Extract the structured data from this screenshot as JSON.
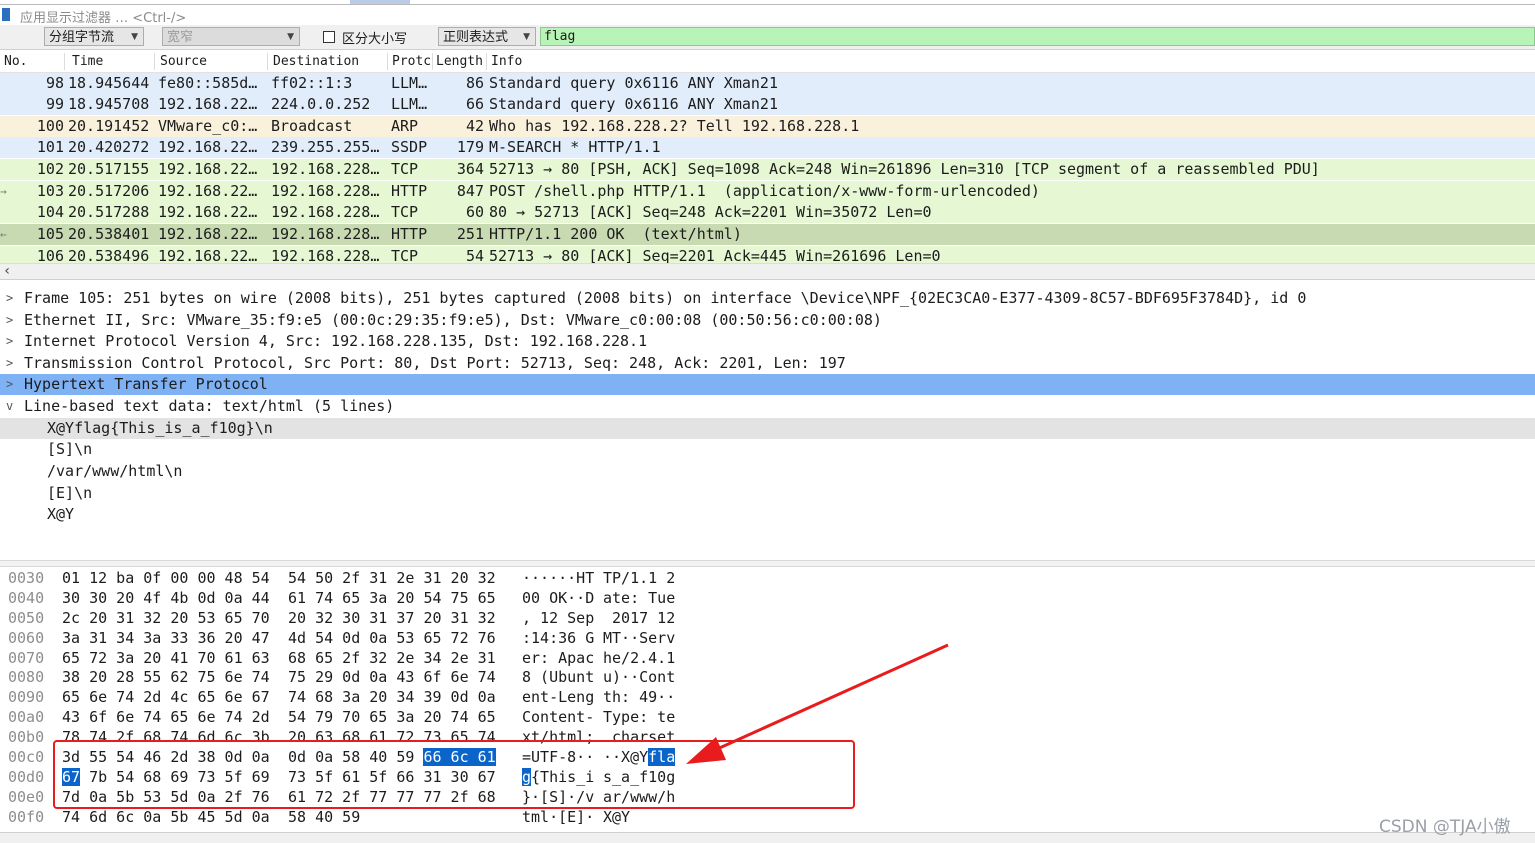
{
  "filter": {
    "placeholder": "应用显示过滤器 … <Ctrl-/>"
  },
  "find": {
    "display": "分组字节流",
    "charset": "宽窄",
    "case_label": "区分大小写",
    "search_type": "正则表达式",
    "query": "flag"
  },
  "packet_list": {
    "columns": [
      "No.",
      "Time",
      "Source",
      "Destination",
      "Protc",
      "Length",
      "Info"
    ],
    "rows": [
      {
        "no": "98",
        "time": "18.945644",
        "src": "fe80::585d…",
        "dst": "ff02::1:3",
        "proto": "LLM…",
        "len": "86",
        "info": "Standard query 0x6116 ANY Xman21",
        "bg": "#e2edfb"
      },
      {
        "no": "99",
        "time": "18.945708",
        "src": "192.168.22…",
        "dst": "224.0.0.252",
        "proto": "LLM…",
        "len": "66",
        "info": "Standard query 0x6116 ANY Xman21",
        "bg": "#e2edfb"
      },
      {
        "no": "100",
        "time": "20.191452",
        "src": "VMware_c0:…",
        "dst": "Broadcast",
        "proto": "ARP",
        "len": "42",
        "info": "Who has 192.168.228.2? Tell 192.168.228.1",
        "bg": "#faf1dd"
      },
      {
        "no": "101",
        "time": "20.420272",
        "src": "192.168.22…",
        "dst": "239.255.255…",
        "proto": "SSDP",
        "len": "179",
        "info": "M-SEARCH * HTTP/1.1",
        "bg": "#e2edfb"
      },
      {
        "no": "102",
        "time": "20.517155",
        "src": "192.168.22…",
        "dst": "192.168.228…",
        "proto": "TCP",
        "len": "364",
        "info": "52713 → 80 [PSH, ACK] Seq=1098 Ack=248 Win=261896 Len=310 [TCP segment of a reassembled PDU]",
        "bg": "#e6f7d4"
      },
      {
        "no": "103",
        "time": "20.517206",
        "src": "192.168.22…",
        "dst": "192.168.228…",
        "proto": "HTTP",
        "len": "847",
        "info": "POST /shell.php HTTP/1.1  (application/x-www-form-urlencoded)",
        "bg": "#e6f7d4"
      },
      {
        "no": "104",
        "time": "20.517288",
        "src": "192.168.22…",
        "dst": "192.168.228…",
        "proto": "TCP",
        "len": "60",
        "info": "80 → 52713 [ACK] Seq=248 Ack=2201 Win=35072 Len=0",
        "bg": "#e6f7d4"
      },
      {
        "no": "105",
        "time": "20.538401",
        "src": "192.168.22…",
        "dst": "192.168.228…",
        "proto": "HTTP",
        "len": "251",
        "info": "HTTP/1.1 200 OK  (text/html)",
        "bg": "#c8dab2"
      },
      {
        "no": "106",
        "time": "20.538496",
        "src": "192.168.22…",
        "dst": "192.168.228…",
        "proto": "TCP",
        "len": "54",
        "info": "52713 → 80 [ACK] Seq=2201 Ack=445 Win=261696 Len=0",
        "bg": "#e6f7d4"
      }
    ]
  },
  "details": {
    "rows": [
      {
        "text": "Frame 105: 251 bytes on wire (2008 bits), 251 bytes captured (2008 bits) on interface \\Device\\NPF_{02EC3CA0-E377-4309-8C57-BDF695F3784D}, id 0",
        "expand": ">"
      },
      {
        "text": "Ethernet II, Src: VMware_35:f9:e5 (00:0c:29:35:f9:e5), Dst: VMware_c0:00:08 (00:50:56:c0:00:08)",
        "expand": ">"
      },
      {
        "text": "Internet Protocol Version 4, Src: 192.168.228.135, Dst: 192.168.228.1",
        "expand": ">"
      },
      {
        "text": "Transmission Control Protocol, Src Port: 80, Dst Port: 52713, Seq: 248, Ack: 2201, Len: 197",
        "expand": ">"
      },
      {
        "text": "Hypertext Transfer Protocol",
        "expand": ">"
      },
      {
        "text": "Line-based text data: text/html (5 lines)",
        "expand": "v"
      }
    ],
    "children": [
      "X@Yflag{This_is_a_f10g}\\n",
      "[S]\\n",
      "/var/www/html\\n",
      "[E]\\n",
      "X@Y"
    ]
  },
  "hex": [
    {
      "off": "0030",
      "h1": "01 12 ba 0f 00 00 48 54",
      "h2": "54 50 2f 31 2e 31 20 32",
      "a1": "······HT",
      "a2": "TP/1.1 2"
    },
    {
      "off": "0040",
      "h1": "30 30 20 4f 4b 0d 0a 44",
      "h2": "61 74 65 3a 20 54 75 65",
      "a1": "00 OK··D",
      "a2": "ate: Tue"
    },
    {
      "off": "0050",
      "h1": "2c 20 31 32 20 53 65 70",
      "h2": "20 32 30 31 37 20 31 32",
      "a1": ", 12 Sep",
      "a2": " 2017 12"
    },
    {
      "off": "0060",
      "h1": "3a 31 34 3a 33 36 20 47",
      "h2": "4d 54 0d 0a 53 65 72 76",
      "a1": ":14:36 G",
      "a2": "MT··Serv"
    },
    {
      "off": "0070",
      "h1": "65 72 3a 20 41 70 61 63",
      "h2": "68 65 2f 32 2e 34 2e 31",
      "a1": "er: Apac",
      "a2": "he/2.4.1"
    },
    {
      "off": "0080",
      "h1": "38 20 28 55 62 75 6e 74",
      "h2": "75 29 0d 0a 43 6f 6e 74",
      "a1": "8 (Ubunt",
      "a2": "u)··Cont"
    },
    {
      "off": "0090",
      "h1": "65 6e 74 2d 4c 65 6e 67",
      "h2": "74 68 3a 20 34 39 0d 0a",
      "a1": "ent-Leng",
      "a2": "th: 49··"
    },
    {
      "off": "00a0",
      "h1": "43 6f 6e 74 65 6e 74 2d",
      "h2": "54 79 70 65 3a 20 74 65",
      "a1": "Content-",
      "a2": "Type: te"
    },
    {
      "off": "00b0",
      "h1": "78 74 2f 68 74 6d 6c 3b",
      "h2": "20 63 68 61 72 73 65 74",
      "a1": "xt/html;",
      "a2": " charset"
    },
    {
      "off": "00c0",
      "h1": "3d 55 54 46 2d 38 0d 0a",
      "h2": "0d 0a 58 40 59 ",
      "h2sel": "66 6c 61",
      "a1": "=UTF-8··",
      "a2": "··X@Y",
      "a2sel": "fla"
    },
    {
      "off": "00d0",
      "h1sel": "67",
      "h1": " 7b 54 68 69 73 5f 69",
      "h2": "73 5f 61 5f 66 31 30 67",
      "a1sel": "g",
      "a1": "{This_i",
      "a2": "s_a_f10g"
    },
    {
      "off": "00e0",
      "h1": "7d 0a 5b 53 5d 0a 2f 76",
      "h2": "61 72 2f 77 77 77 2f 68",
      "a1": "}·[S]·/v",
      "a2": "ar/www/h"
    },
    {
      "off": "00f0",
      "h1": "74 6d 6c 0a 5b 45 5d 0a",
      "h2": "58 40 59",
      "a1": "tml·[E]·",
      "a2": "X@Y"
    }
  ],
  "watermark": "CSDN @TJA小傲"
}
